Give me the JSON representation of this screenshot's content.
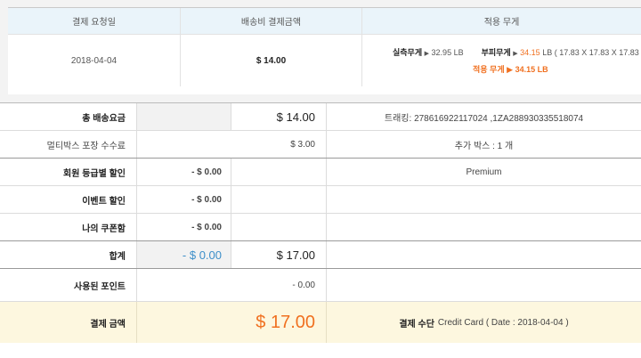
{
  "summary": {
    "headers": [
      "결제 요청일",
      "배송비 결제금액",
      "적용 무게"
    ],
    "request_date": "2018-04-04",
    "shipping_amount": "$ 14.00",
    "actual_weight_label": "실측무게",
    "actual_weight_value": "32.95 LB",
    "volume_weight_label": "부피무게",
    "volume_weight_value": "34.15",
    "volume_weight_detail": "LB ( 17.83 X 17.83 X 17.83 )",
    "applied_weight_label": "적용 무게",
    "applied_weight_value": "34.15 LB",
    "arrow": "▶"
  },
  "details": {
    "total_shipping_label": "총 배송요금",
    "total_shipping_value": "$ 14.00",
    "tracking": "트래킹: 278616922117024 ,1ZA288930335518074",
    "multibox_label": "멀티박스 포장 수수료",
    "multibox_value": "$ 3.00",
    "extra_box": "추가 박스 : 1 개",
    "member_discount_label": "회원 등급별 할인",
    "member_discount_value": "- $ 0.00",
    "member_grade": "Premium",
    "event_discount_label": "이벤트 할인",
    "event_discount_value": "- $ 0.00",
    "coupon_label": "나의 쿠폰함",
    "coupon_value": "- $ 0.00",
    "sum_label": "합계",
    "sum_discount": "- $ 0.00",
    "sum_total": "$ 17.00",
    "points_label": "사용된 포인트",
    "points_value": "- 0.00",
    "payment_label": "결제 금액",
    "payment_value": "$ 17.00",
    "payment_method_label": "결제 수단",
    "payment_method_value": "Credit Card ( Date : 2018-04-04 )"
  }
}
